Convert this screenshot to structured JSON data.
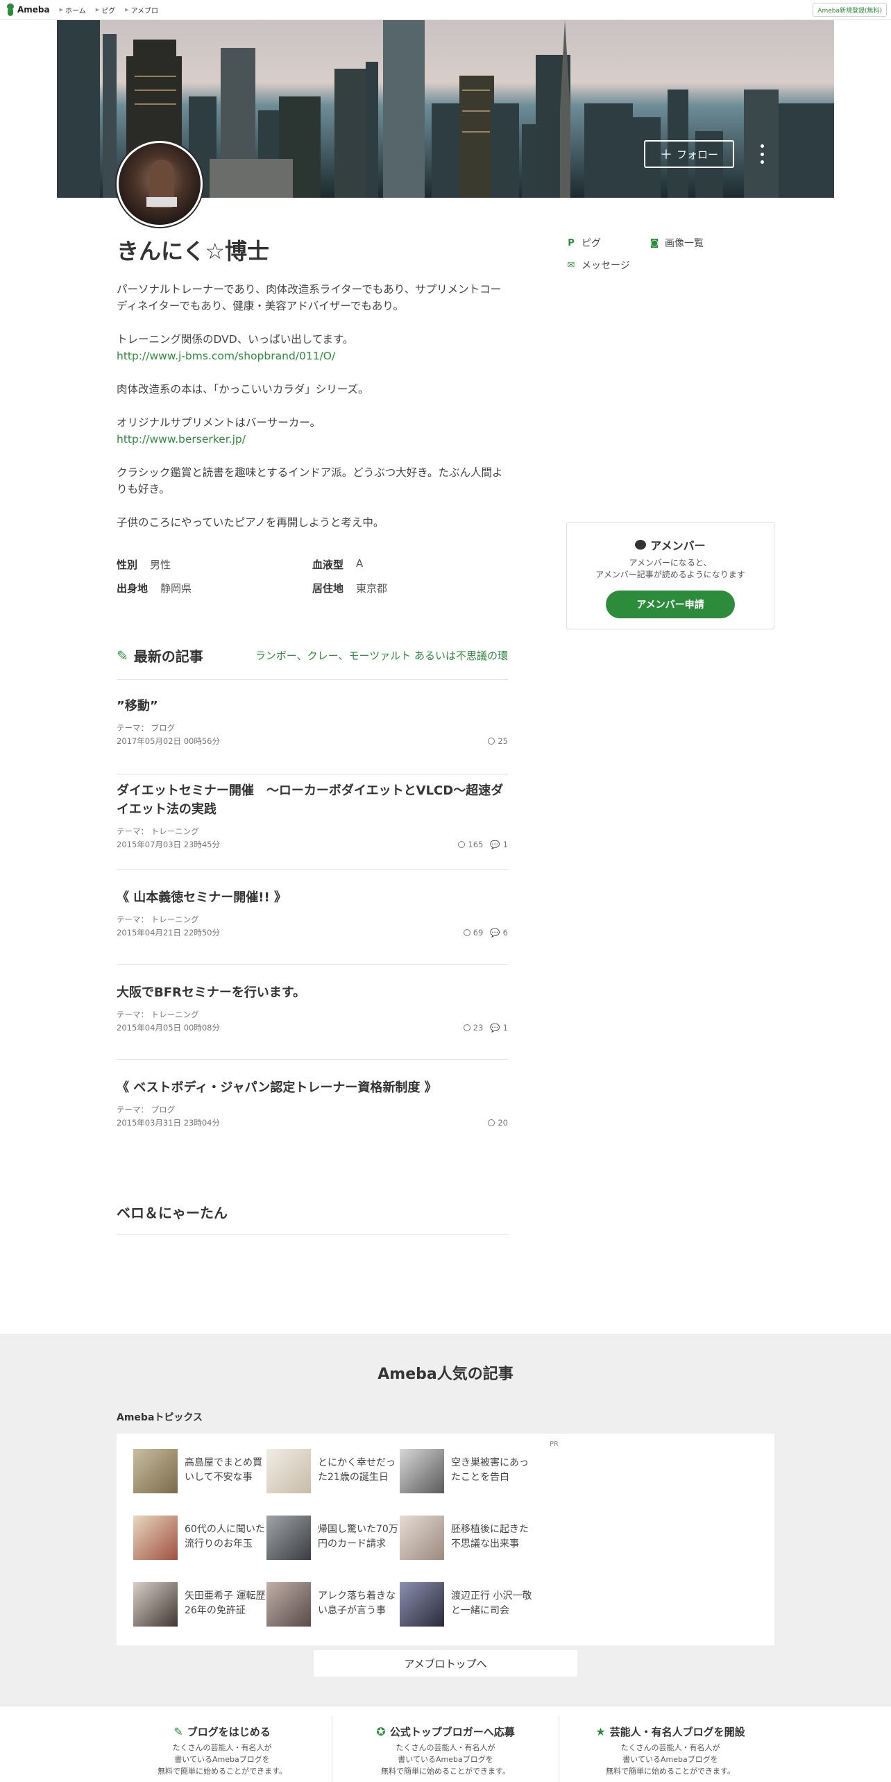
{
  "nav": {
    "logo": "Ameba",
    "links": [
      "ホーム",
      "ピグ",
      "アメブロ"
    ],
    "signup": "Ameba新規登録(無料)"
  },
  "profile": {
    "follow_label": "フォロー",
    "name": "きんにく☆博士",
    "bio": [
      "パーソナルトレーナーであり、肉体改造系ライターでもあり、サプリメントコーディネイターでもあり、健康・美容アドバイザーでもあり。",
      "トレーニング関係のDVD、いっぱい出してます。",
      "http://www.j-bms.com/shopbrand/011/O/",
      "肉体改造系の本は、「かっこいいカラダ」シリーズ。",
      "オリジナルサプリメントはバーサーカー。",
      "http://www.berserker.jp/",
      "クラシック鑑賞と読書を趣味とするインドア派。どうぶつ大好き。たぶん人間よりも好き。",
      "子供のころにやっていたピアノを再開しようと考え中。"
    ],
    "side_links": [
      "ピグ",
      "画像一覧",
      "メッセージ"
    ],
    "facts": [
      {
        "key": "性別",
        "value": "男性"
      },
      {
        "key": "血液型",
        "value": "A"
      },
      {
        "key": "出身地",
        "value": "静岡県"
      },
      {
        "key": "居住地",
        "value": "東京都"
      }
    ]
  },
  "member": {
    "title": "アメンバー",
    "desc_line1": "アメンバーになると、",
    "desc_line2": "アメンバー記事が読めるようになります",
    "button": "アメンバー申請"
  },
  "articles_section": {
    "title": "最新の記事",
    "link": "ランボー、クレー、モーツァルト あるいは不思議の環"
  },
  "articles": [
    {
      "title": "”移動”",
      "theme": "テーマ： ブログ",
      "date": "2017年05月02日 00時56分",
      "views": "25",
      "comments": ""
    },
    {
      "title": "ダイエットセミナー開催　～ローカーボダイエットとVLCD～超速ダイエット法の実践",
      "theme": "テーマ： トレーニング",
      "date": "2015年07月03日 23時45分",
      "views": "165",
      "comments": "1"
    },
    {
      "title": "《 山本義徳セミナー開催!! 》",
      "theme": "テーマ： トレーニング",
      "date": "2015年04月21日 22時50分",
      "views": "69",
      "comments": "6"
    },
    {
      "title": "大阪でBFRセミナーを行います。",
      "theme": "テーマ： トレーニング",
      "date": "2015年04月05日 00時08分",
      "views": "23",
      "comments": "1"
    },
    {
      "title": "《 ベストボディ・ジャパン認定トレーナー資格新制度 》",
      "theme": "テーマ： ブログ",
      "date": "2015年03月31日 23時04分",
      "views": "20",
      "comments": ""
    }
  ],
  "bero_section": {
    "title": "ベロ＆にゃーたん"
  },
  "popular": {
    "title": "Ameba人気の記事",
    "subtitle": "Amebaトピックス",
    "pr": "PR",
    "topics": [
      "高島屋でまとめ買いして不安な事",
      "とにかく幸せだった21歳の誕生日",
      "空き巣被害にあったことを告白",
      "60代の人に聞いた流行りのお年玉",
      "帰国し驚いた70万円のカード請求",
      "胚移植後に起きた不思議な出来事",
      "矢田亜希子 運転歴26年の免許証",
      "アレク落ち着きない息子が言う事",
      "渡辺正行 小沢一敬と一緒に司会"
    ],
    "top_button": "アメブロトップへ"
  },
  "promos": [
    {
      "title": "ブログをはじめる",
      "desc": [
        "たくさんの芸能人・有名人が",
        "書いているAmebaブログを",
        "無料で簡単に始めることができます。"
      ]
    },
    {
      "title": "公式トップブロガーへ応募",
      "desc": [
        "たくさんの芸能人・有名人が",
        "書いているAmebaブログを",
        "無料で簡単に始めることができます。"
      ]
    },
    {
      "title": "芸能人・有名人ブログを開設",
      "desc": [
        "たくさんの芸能人・有名人が",
        "書いているAmebaブログを",
        "無料で簡単に始めることができます。"
      ]
    }
  ]
}
